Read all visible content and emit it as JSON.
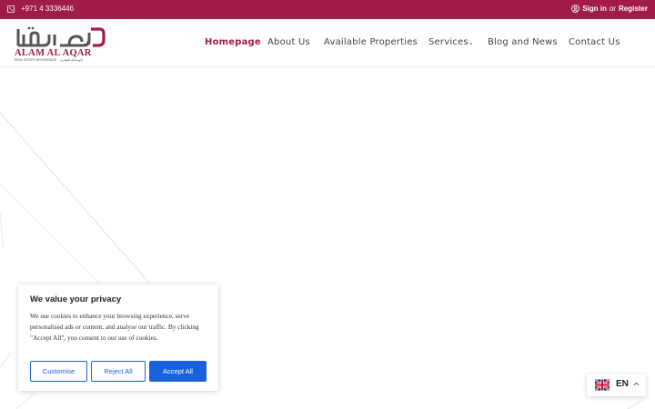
{
  "topbar": {
    "phone": "+971 4 3336446",
    "sign_in": "Sign in",
    "or": "or",
    "register": "Register"
  },
  "logo": {
    "arabic": "العقار",
    "latin": "ALAM AL AQAR",
    "tagline": "REAL ESTATE BROKERAGE",
    "arabic_tagline": "للوساطة العقارية"
  },
  "nav": {
    "items": [
      {
        "label": "Homepage",
        "active": true
      },
      {
        "label": "About Us",
        "active": false
      },
      {
        "label": "Available Properties",
        "active": false
      },
      {
        "label": "Services",
        "active": false,
        "has_dropdown": true
      },
      {
        "label": "Blog and News",
        "active": false
      },
      {
        "label": "Contact Us",
        "active": false
      }
    ],
    "dropdown_caret": "⌄"
  },
  "cookie": {
    "title": "We value your privacy",
    "body": "We use cookies to enhance your browsing experience, serve personalised ads or content, and analyse our traffic. By clicking \"Accept All\", you consent to our use of cookies.",
    "customise": "Customise",
    "reject": "Reject All",
    "accept": "Accept All"
  },
  "language": {
    "code": "EN",
    "flag": "uk-flag-icon"
  },
  "colors": {
    "brand": "#a01c46",
    "button": "#1863dc"
  }
}
